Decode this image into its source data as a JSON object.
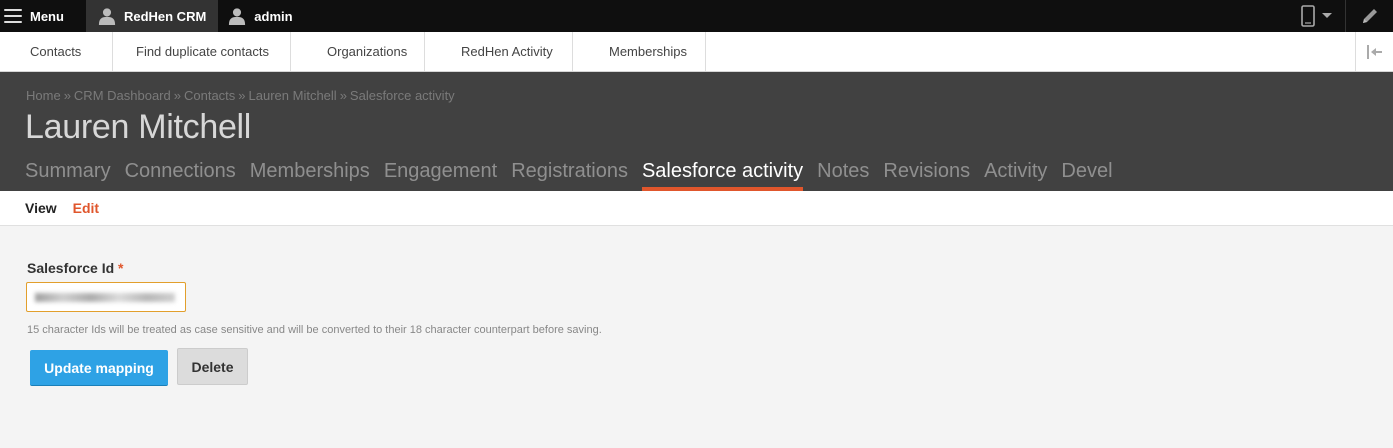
{
  "toolbar": {
    "menu_label": "Menu",
    "crm_label": "RedHen CRM",
    "user_label": "admin",
    "icons": {
      "menu": "hamburger-icon",
      "crm": "person-icon",
      "user": "user-icon",
      "device": "mobile-device-icon",
      "edit": "pencil-icon"
    }
  },
  "tray": {
    "links": [
      {
        "label": "Contacts"
      },
      {
        "label": "Find duplicate contacts"
      },
      {
        "label": "Organizations"
      },
      {
        "label": "RedHen Activity"
      },
      {
        "label": "Memberships"
      }
    ]
  },
  "header": {
    "breadcrumb": [
      "Home",
      "CRM Dashboard",
      "Contacts",
      "Lauren Mitchell",
      "Salesforce activity"
    ],
    "breadcrumb_separator": "»",
    "title": "Lauren Mitchell",
    "tabs": [
      {
        "label": "Summary",
        "active": false
      },
      {
        "label": "Connections",
        "active": false
      },
      {
        "label": "Memberships",
        "active": false
      },
      {
        "label": "Engagement",
        "active": false
      },
      {
        "label": "Registrations",
        "active": false
      },
      {
        "label": "Salesforce activity",
        "active": true
      },
      {
        "label": "Notes",
        "active": false
      },
      {
        "label": "Revisions",
        "active": false
      },
      {
        "label": "Activity",
        "active": false
      },
      {
        "label": "Devel",
        "active": false
      }
    ]
  },
  "subtabs": {
    "view_label": "View",
    "edit_label": "Edit"
  },
  "form": {
    "field_label": "Salesforce Id",
    "required_marker": "*",
    "help_text": "15 character Ids will be treated as case sensitive and will be converted to their 18 character counterpart before saving.",
    "update_button": "Update mapping",
    "delete_button": "Delete"
  },
  "colors": {
    "accent": "#e0562c",
    "primary_button": "#2ea2e5",
    "header_bg": "#414141",
    "toolbar_bg": "#0f0f0f"
  }
}
